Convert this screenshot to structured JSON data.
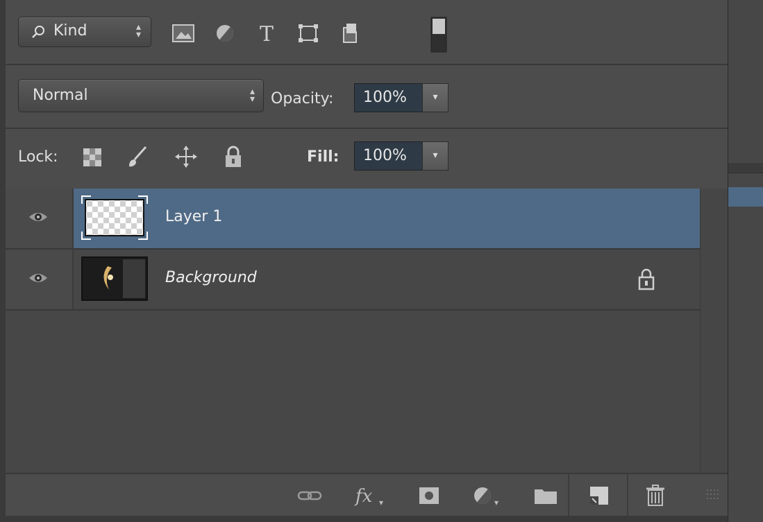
{
  "filter_bar": {
    "kind_label": "Kind",
    "icons": [
      "image-filter-icon",
      "adjustment-filter-icon",
      "type-filter-icon",
      "shape-filter-icon",
      "smart-object-filter-icon",
      "filter-toggle-icon"
    ]
  },
  "blend_bar": {
    "mode": "Normal",
    "opacity_label": "Opacity:",
    "opacity_value": "100%"
  },
  "lock_bar": {
    "lock_label": "Lock:",
    "fill_label": "Fill:",
    "fill_value": "100%"
  },
  "layers": [
    {
      "name": "Layer 1",
      "selected": true,
      "visible": true,
      "locked": false
    },
    {
      "name": "Background",
      "selected": false,
      "visible": true,
      "locked": true
    }
  ],
  "footer": {
    "icons": [
      "link-layers-icon",
      "fx-icon",
      "layer-mask-icon",
      "adjustment-layer-icon",
      "group-folder-icon",
      "new-layer-icon",
      "trash-icon"
    ]
  },
  "colors": {
    "panel_bg": "#4c4c4c",
    "selection": "#4f6a86",
    "value_field": "#2e3a45"
  }
}
